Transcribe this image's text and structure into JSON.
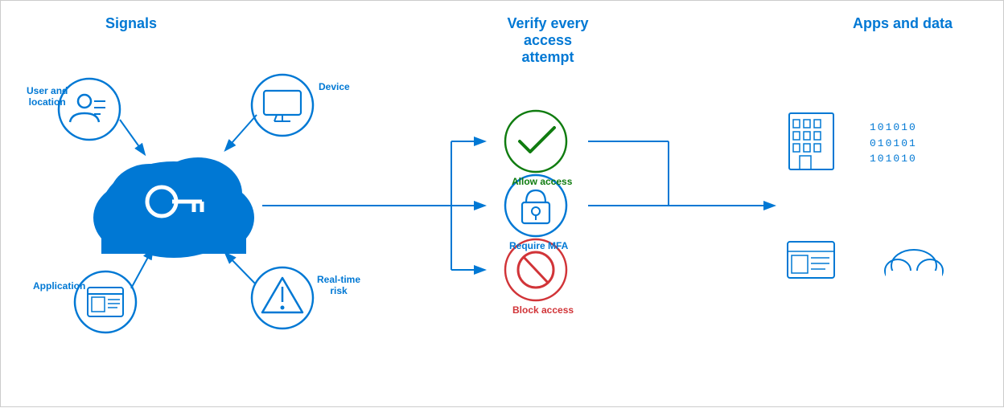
{
  "sections": {
    "signals": {
      "title": "Signals",
      "items": [
        {
          "id": "user-location",
          "label": "User and\nlocation",
          "icon": "user-list"
        },
        {
          "id": "device",
          "label": "Device",
          "icon": "monitor"
        },
        {
          "id": "application",
          "label": "Application",
          "icon": "app-window"
        },
        {
          "id": "realtime-risk",
          "label": "Real-time\nrisk",
          "icon": "warning"
        }
      ]
    },
    "verify": {
      "title": "Verify every access\nattempt",
      "items": [
        {
          "id": "allow",
          "label": "Allow access",
          "color": "#107c10",
          "icon": "check"
        },
        {
          "id": "mfa",
          "label": "Require MFA",
          "color": "#0078d4",
          "icon": "lock"
        },
        {
          "id": "block",
          "label": "Block access",
          "color": "#d13438",
          "icon": "block"
        }
      ]
    },
    "apps": {
      "title": "Apps and data",
      "items": [
        {
          "id": "building",
          "icon": "building"
        },
        {
          "id": "data-binary",
          "icon": "binary"
        },
        {
          "id": "app-ui",
          "icon": "app-ui"
        },
        {
          "id": "cloud-storage",
          "icon": "cloud"
        }
      ]
    }
  },
  "colors": {
    "primary": "#0078d4",
    "allow": "#107c10",
    "block": "#d13438",
    "mfa": "#0078d4"
  }
}
